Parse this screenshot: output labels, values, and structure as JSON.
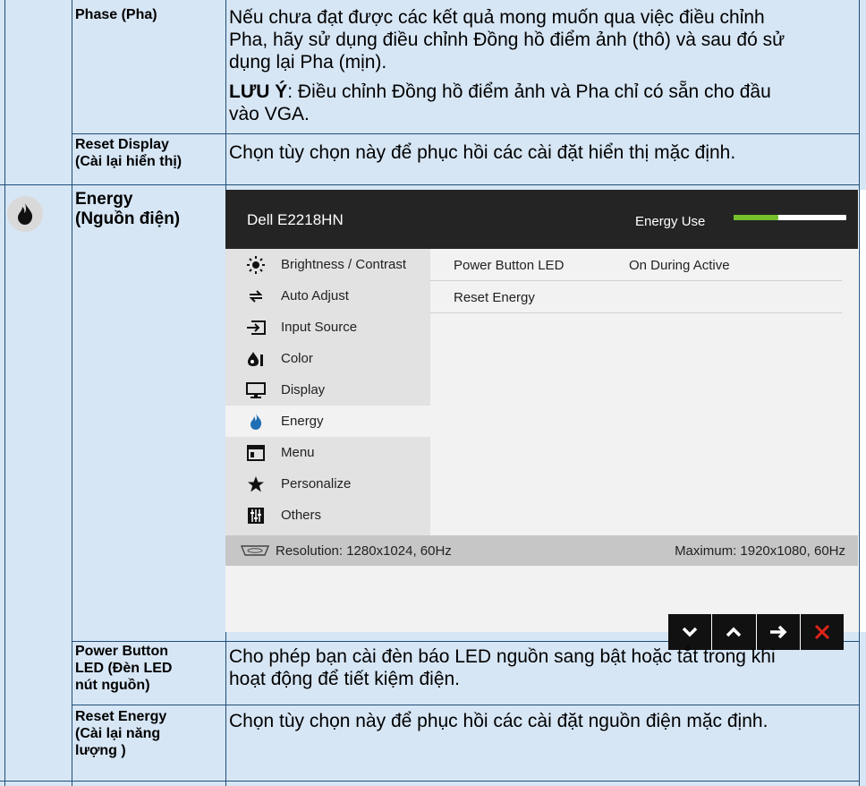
{
  "rows": {
    "phase": {
      "label": "Phase (Pha)",
      "desc_line1": "Nếu chưa đạt được các kết quả mong muốn qua việc điều chỉnh",
      "desc_line2": "Pha, hãy sử dụng điều chỉnh Đồng hồ điểm ảnh (thô) và sau đó sử",
      "desc_line3": "dụng lại Pha (mịn).",
      "note_bold": "LƯU Ý",
      "note_line1": ": Điều chỉnh Đồng hồ điểm ảnh và Pha chỉ có sẵn cho đầu",
      "note_line2": "vào VGA."
    },
    "reset_display": {
      "label_line1": "Reset Display",
      "label_line2": "(Cài lại hiển thị)",
      "desc": "Chọn tùy chọn này để phục hồi các cài đặt hiển thị mặc định."
    },
    "energy": {
      "label_line1": "Energy",
      "label_line2": "(Nguồn điện)"
    },
    "power_button_led": {
      "label_line1": "Power Button",
      "label_line2": "LED (Đèn LED",
      "label_line3": "nút nguồn)",
      "desc_line1": "Cho phép bạn cài đèn báo LED nguồn sang bật hoặc tắt trong khi",
      "desc_line2": "hoạt động để tiết kiệm điện."
    },
    "reset_energy": {
      "label_line1": "Reset Energy",
      "label_line2": "(Cài lại năng",
      "label_line3": "lượng )",
      "desc": "Chọn tùy chọn này để phục hồi các cài đặt nguồn điện mặc định."
    }
  },
  "osd": {
    "model": "Dell E2218HN",
    "energy_use_label": "Energy Use",
    "energy_level": 0.4,
    "menu": [
      {
        "label": "Brightness / Contrast",
        "icon": "sun-icon"
      },
      {
        "label": "Auto Adjust",
        "icon": "auto-adjust-icon"
      },
      {
        "label": "Input Source",
        "icon": "input-source-icon"
      },
      {
        "label": "Color",
        "icon": "color-icon"
      },
      {
        "label": "Display",
        "icon": "monitor-icon"
      },
      {
        "label": "Energy",
        "icon": "flame-icon"
      },
      {
        "label": "Menu",
        "icon": "menu-icon"
      },
      {
        "label": "Personalize",
        "icon": "star-icon"
      },
      {
        "label": "Others",
        "icon": "sliders-icon"
      }
    ],
    "active_menu": "Energy",
    "submenu": [
      {
        "label": "Power Button LED",
        "value": "On During Active"
      },
      {
        "label": "Reset Energy",
        "value": ""
      }
    ],
    "resolution": "Resolution: 1280x1024, 60Hz",
    "maximum": "Maximum: 1920x1080, 60Hz",
    "nav_icons": [
      "chevron-down-icon",
      "chevron-up-icon",
      "arrow-right-icon",
      "close-icon"
    ],
    "colors": {
      "header_bg": "#242424",
      "meter_fill": "#73c02a",
      "close": "#e0231b",
      "row_bg": "#d7e6f5",
      "energy_icon": "#1f6fb5"
    }
  }
}
